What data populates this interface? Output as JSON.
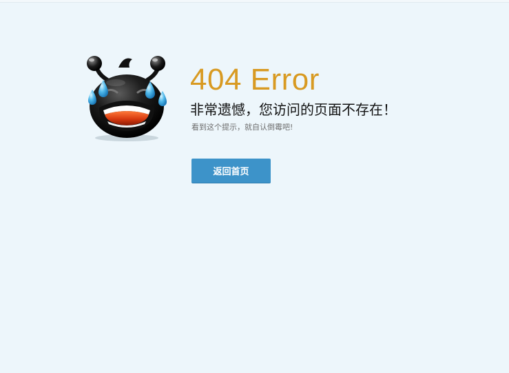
{
  "error": {
    "code": "404 Error",
    "headline": "非常遗憾，您访问的页面不存在！",
    "hint": "看到这个提示，就自认倒霉吧!"
  },
  "actions": {
    "back_home_label": "返回首页"
  },
  "colors": {
    "background": "#edf6fb",
    "error_code": "#d89a22",
    "button": "#3d93c9"
  },
  "icons": {
    "mascot": "crying-face-icon"
  }
}
